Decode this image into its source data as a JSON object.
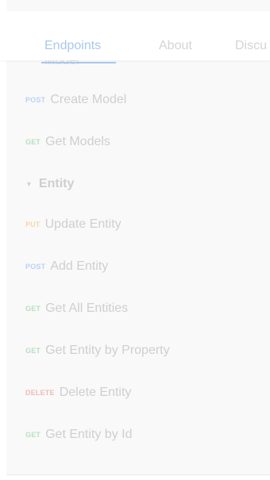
{
  "tabs": [
    {
      "label": "Endpoints",
      "active": true
    },
    {
      "label": "About",
      "active": false
    },
    {
      "label": "Discu",
      "active": false
    }
  ],
  "peek_text": "Model",
  "model_items": [
    {
      "method": "POST",
      "label": "Create Model"
    },
    {
      "method": "GET",
      "label": "Get Models"
    }
  ],
  "entity_section": {
    "label": "Entity",
    "expanded": true,
    "caret": "▼"
  },
  "entity_items": [
    {
      "method": "PUT",
      "label": "Update Entity"
    },
    {
      "method": "POST",
      "label": "Add Entity"
    },
    {
      "method": "GET",
      "label": "Get All Entities"
    },
    {
      "method": "GET",
      "label": "Get Entity by Property"
    },
    {
      "method": "DELETE",
      "label": "Delete Entity"
    },
    {
      "method": "GET",
      "label": "Get Entity by Id"
    }
  ],
  "colors": {
    "accent": "#a9c7ec",
    "post": "#b9d3f2",
    "get": "#b7dfc3",
    "put": "#f4d9a8",
    "delete": "#f2b9b9"
  }
}
